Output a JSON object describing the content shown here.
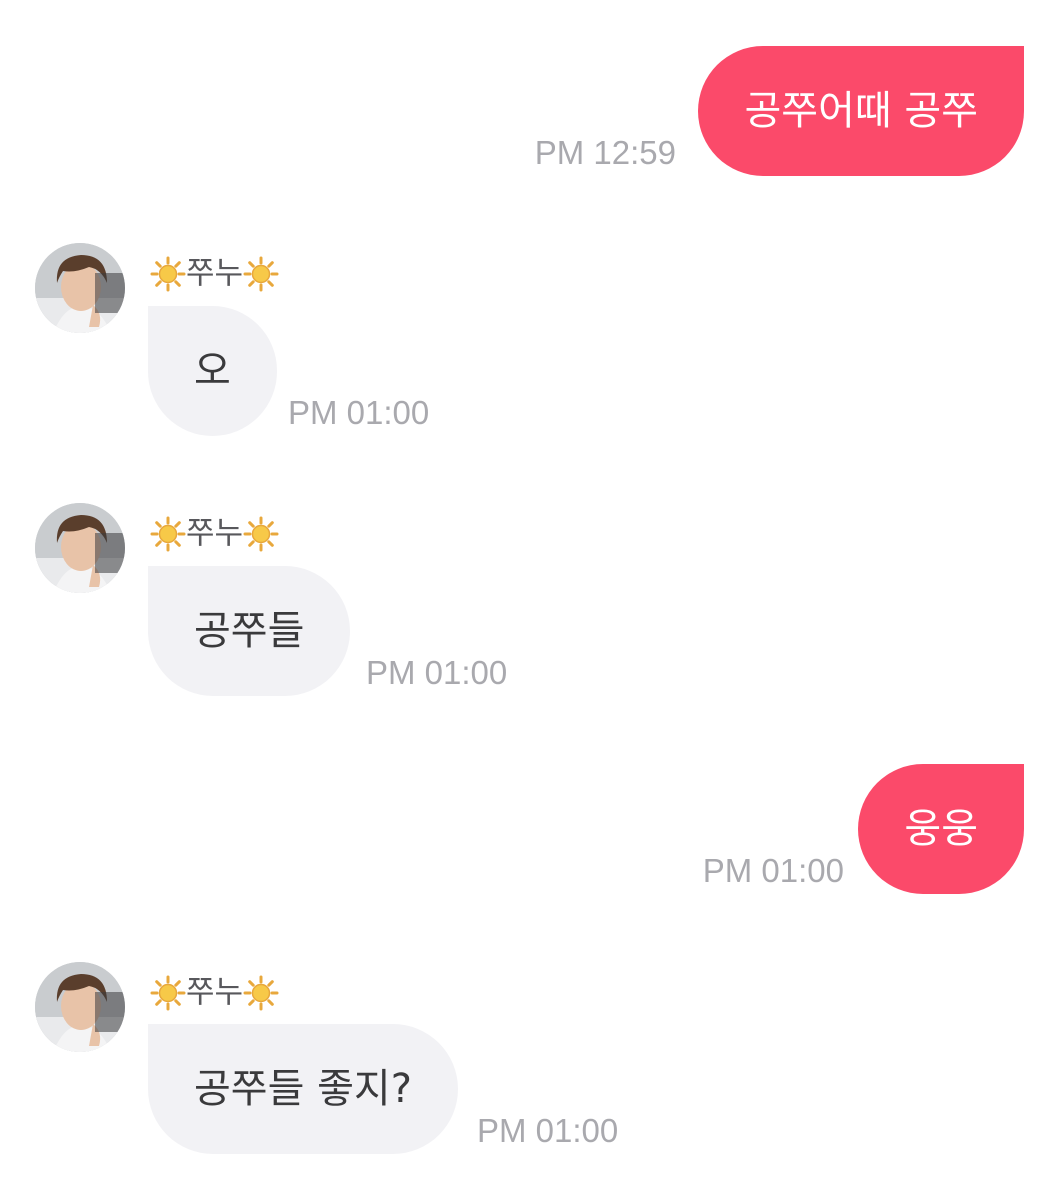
{
  "messages": [
    {
      "direction": "out",
      "text": "공쭈어때 공쭈",
      "time": "PM 12:59"
    },
    {
      "direction": "in",
      "sender": "쭈누",
      "sender_decoration": "sun-emoji",
      "text": "오",
      "time": "PM 01:00"
    },
    {
      "direction": "in",
      "sender": "쭈누",
      "sender_decoration": "sun-emoji",
      "text": "공쭈들",
      "time": "PM 01:00"
    },
    {
      "direction": "out",
      "text": "웅웅",
      "time": "PM 01:00"
    },
    {
      "direction": "in",
      "sender": "쭈누",
      "sender_decoration": "sun-emoji",
      "text": "공쭈들 좋지?",
      "time": "PM 01:00"
    }
  ],
  "colors": {
    "outgoing_bubble": "#fb4a6a",
    "incoming_bubble": "#f2f2f5",
    "timestamp": "#a9a9ae",
    "sender_name": "#58585c"
  }
}
